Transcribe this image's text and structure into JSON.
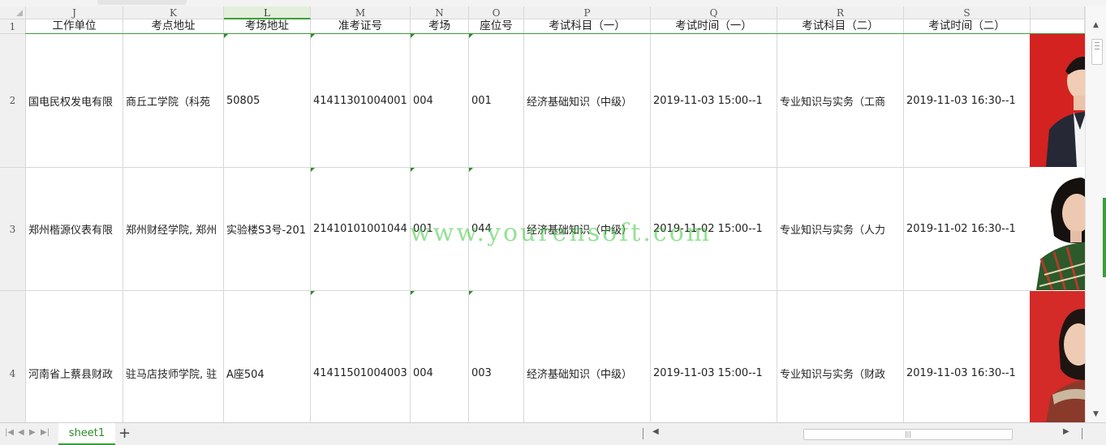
{
  "columns": [
    {
      "letter": "J",
      "header": "工作单位"
    },
    {
      "letter": "K",
      "header": "考点地址"
    },
    {
      "letter": "L",
      "header": "考场地址"
    },
    {
      "letter": "M",
      "header": "准考证号"
    },
    {
      "letter": "N",
      "header": "考场"
    },
    {
      "letter": "O",
      "header": "座位号"
    },
    {
      "letter": "P",
      "header": "考试科目（一）"
    },
    {
      "letter": "Q",
      "header": "考试时间（一）"
    },
    {
      "letter": "R",
      "header": "考试科目（二）"
    },
    {
      "letter": "S",
      "header": "考试时间（二）"
    }
  ],
  "selected_column": "L",
  "header_row_number": "1",
  "rows": [
    {
      "number": "2",
      "cells": [
        "国电民权发电有限",
        "商丘工学院（科苑",
        "50805",
        "41411301004001",
        "004",
        "001",
        "经济基础知识（中级）",
        "2019-11-03 15:00--1",
        "专业知识与实务（工商",
        "2019-11-03 16:30--1"
      ],
      "photo_bg": "#d32220",
      "photo_coat": "#2b2d3a"
    },
    {
      "number": "3",
      "cells": [
        "郑州楷源仪表有限",
        "郑州财经学院, 郑州",
        "实验楼S3号-201",
        "21410101001044",
        "001",
        "044",
        "经济基础知识（中级）",
        "2019-11-02 15:00--1",
        "专业知识与实务（人力",
        "2019-11-02 16:30--1"
      ],
      "photo_bg": "#ffffff",
      "photo_coat": "#2c5a2a"
    },
    {
      "number": "4",
      "cells": [
        "河南省上蔡县财政",
        "驻马店技师学院, 驻",
        "A座504",
        "41411501004003",
        "004",
        "003",
        "经济基础知识（中级）",
        "2019-11-03 15:00--1",
        "专业知识与实务（财政",
        "2019-11-03 16:30--1"
      ],
      "photo_bg": "#d42a28",
      "photo_coat": "#8a3a2a"
    }
  ],
  "watermark": "www.yourensoft.com",
  "sheet_tab": "sheet1",
  "colors": {
    "accent": "#3c9e3c",
    "grid": "#d8d8d8",
    "header_bg": "#f0f0f0"
  }
}
